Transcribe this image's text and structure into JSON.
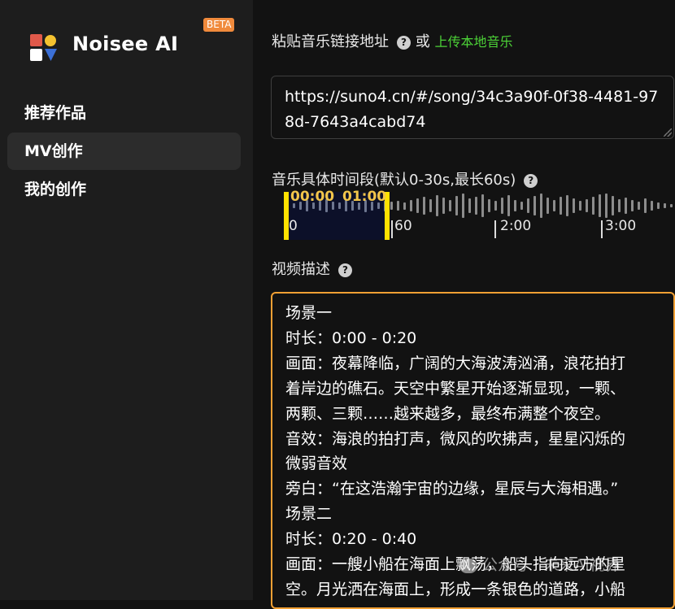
{
  "sidebar": {
    "brand": "Noisee AI",
    "badge": "BETA",
    "nav": [
      {
        "label": "推荐作品"
      },
      {
        "label": "MV创作"
      },
      {
        "label": "我的创作"
      }
    ]
  },
  "main": {
    "paste_label": "粘贴音乐链接地址",
    "or_text": "或",
    "upload_link": "上传本地音乐",
    "url_value": "https://suno4.cn/#/song/34c3a90f-0f38-4481-978d-7643a4cabd74",
    "segment_label": "音乐具体时间段(默认0-30s,最长60s)",
    "timeline": {
      "start_time": "00:00",
      "end_time": "01:00",
      "ticks": [
        "0",
        "60",
        "2:00",
        "3:00"
      ],
      "selected_range_seconds": [
        0,
        60
      ]
    },
    "desc_label": "视频描述",
    "desc_lines": [
      "场景一",
      "时长：0:00 - 0:20",
      "画面：夜幕降临，广阔的大海波涛汹涌，浪花拍打",
      "着岸边的礁石。天空中繁星开始逐渐显现，一颗、",
      "两颗、三颗……越来越多，最终布满整个夜空。",
      "音效：海浪的拍打声，微风的吹拂声，星星闪烁的",
      "微弱音效",
      "旁白：“在这浩瀚宇宙的边缘，星辰与大海相遇。”",
      "场景二",
      "时长：0:20 - 0:40",
      "画面：一艘小船在海面上飘荡，船头指向远方的星",
      "空。月光洒在海面上，形成一条银色的道路，小船"
    ]
  },
  "watermark": "公众号 · 未来AI视界",
  "colors": {
    "accent_link": "#4cd137",
    "handle": "#ffe100",
    "beta": "#f08a3c",
    "focus_border": "#f1a034"
  }
}
